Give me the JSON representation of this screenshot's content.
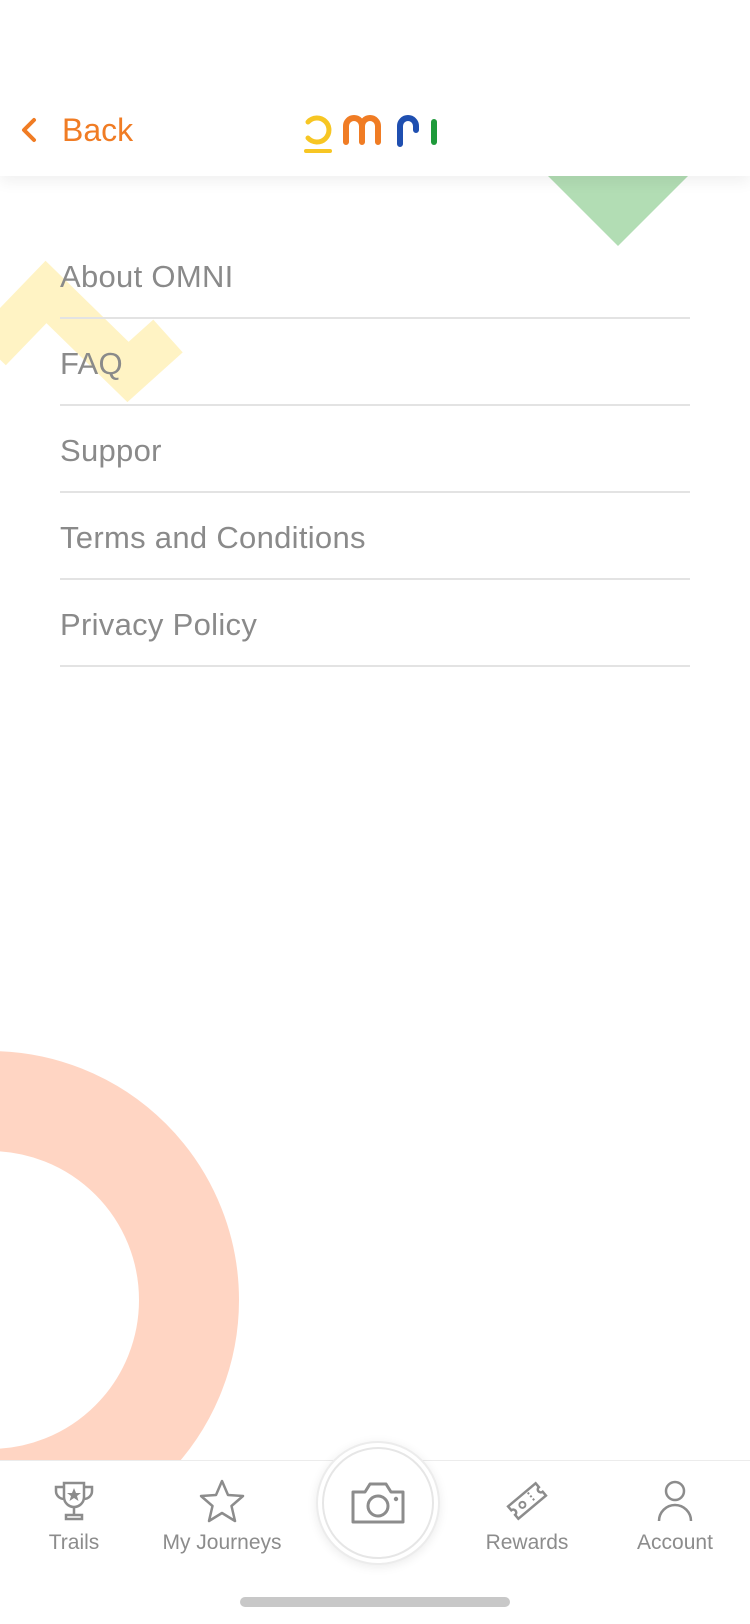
{
  "header": {
    "back_label": "Back",
    "logo_alt": "omni",
    "colors": {
      "accent": "#f07c24",
      "logo_o": "#f7c623",
      "logo_m": "#f07c24",
      "logo_n": "#1f4fb0",
      "logo_i": "#1e9a3a"
    }
  },
  "menu": {
    "items": [
      {
        "label": "About OMNI"
      },
      {
        "label": "FAQ"
      },
      {
        "label": "Suppor"
      },
      {
        "label": "Terms and Conditions"
      },
      {
        "label": "Privacy Policy"
      }
    ]
  },
  "tabbar": {
    "tabs": [
      {
        "label": "Trails",
        "icon": "trophy-icon"
      },
      {
        "label": "My Journeys",
        "icon": "star-icon"
      },
      {
        "label": "",
        "icon": "camera-icon"
      },
      {
        "label": "Rewards",
        "icon": "ticket-icon"
      },
      {
        "label": "Account",
        "icon": "person-icon"
      }
    ]
  },
  "decor_colors": {
    "green": "#b2ddb4",
    "yellow": "#fff3c4",
    "peach": "#ffd5c3"
  }
}
